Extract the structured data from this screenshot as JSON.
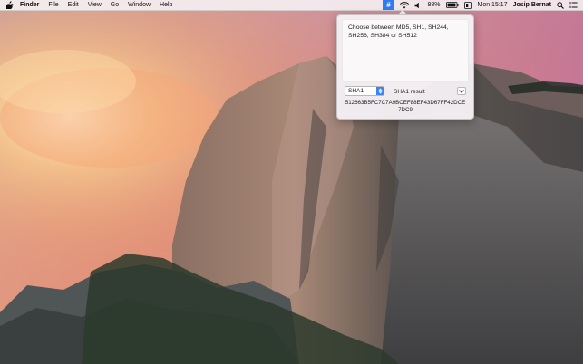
{
  "menubar": {
    "apple_icon": "apple-logo-icon",
    "app_name": "Finder",
    "menus": [
      "File",
      "Edit",
      "View",
      "Go",
      "Window",
      "Help"
    ],
    "status": {
      "hash_app_symbol": "#",
      "battery_percent": "88%",
      "clock": "Mon 15:17",
      "user": "Josip Bernat"
    }
  },
  "popover": {
    "input_text": "Choose between MD5, SH1, SH244,\nSH256, SH384 or SH512",
    "algorithm": {
      "selected": "SHA1"
    },
    "result_label": "SHA1 result",
    "hash_output": "512663B5FC7C7A9BCEF88EF43D67FF42DCE7DC9"
  },
  "colors": {
    "accent": "#2f7bf6",
    "menubar_bg": "#f6f3f5"
  }
}
